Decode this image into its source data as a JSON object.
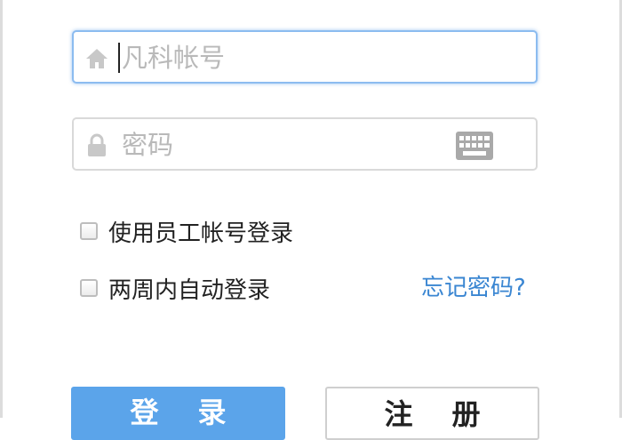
{
  "login_form": {
    "account_field": {
      "placeholder": "凡科帐号",
      "icon": "home-icon"
    },
    "password_field": {
      "placeholder": "密码",
      "icon": "lock-icon",
      "keyboard_icon": "keyboard-icon"
    },
    "employee_login": {
      "label": "使用员工帐号登录",
      "checked": false
    },
    "remember_login": {
      "label": "两周内自动登录",
      "checked": false
    },
    "forgot_password_link": "忘记密码?",
    "login_button": "登录",
    "register_button": "注册"
  },
  "colors": {
    "accent": "#5ba4ea",
    "link": "#3a86d2",
    "focus_border": "#8cbcf0"
  }
}
